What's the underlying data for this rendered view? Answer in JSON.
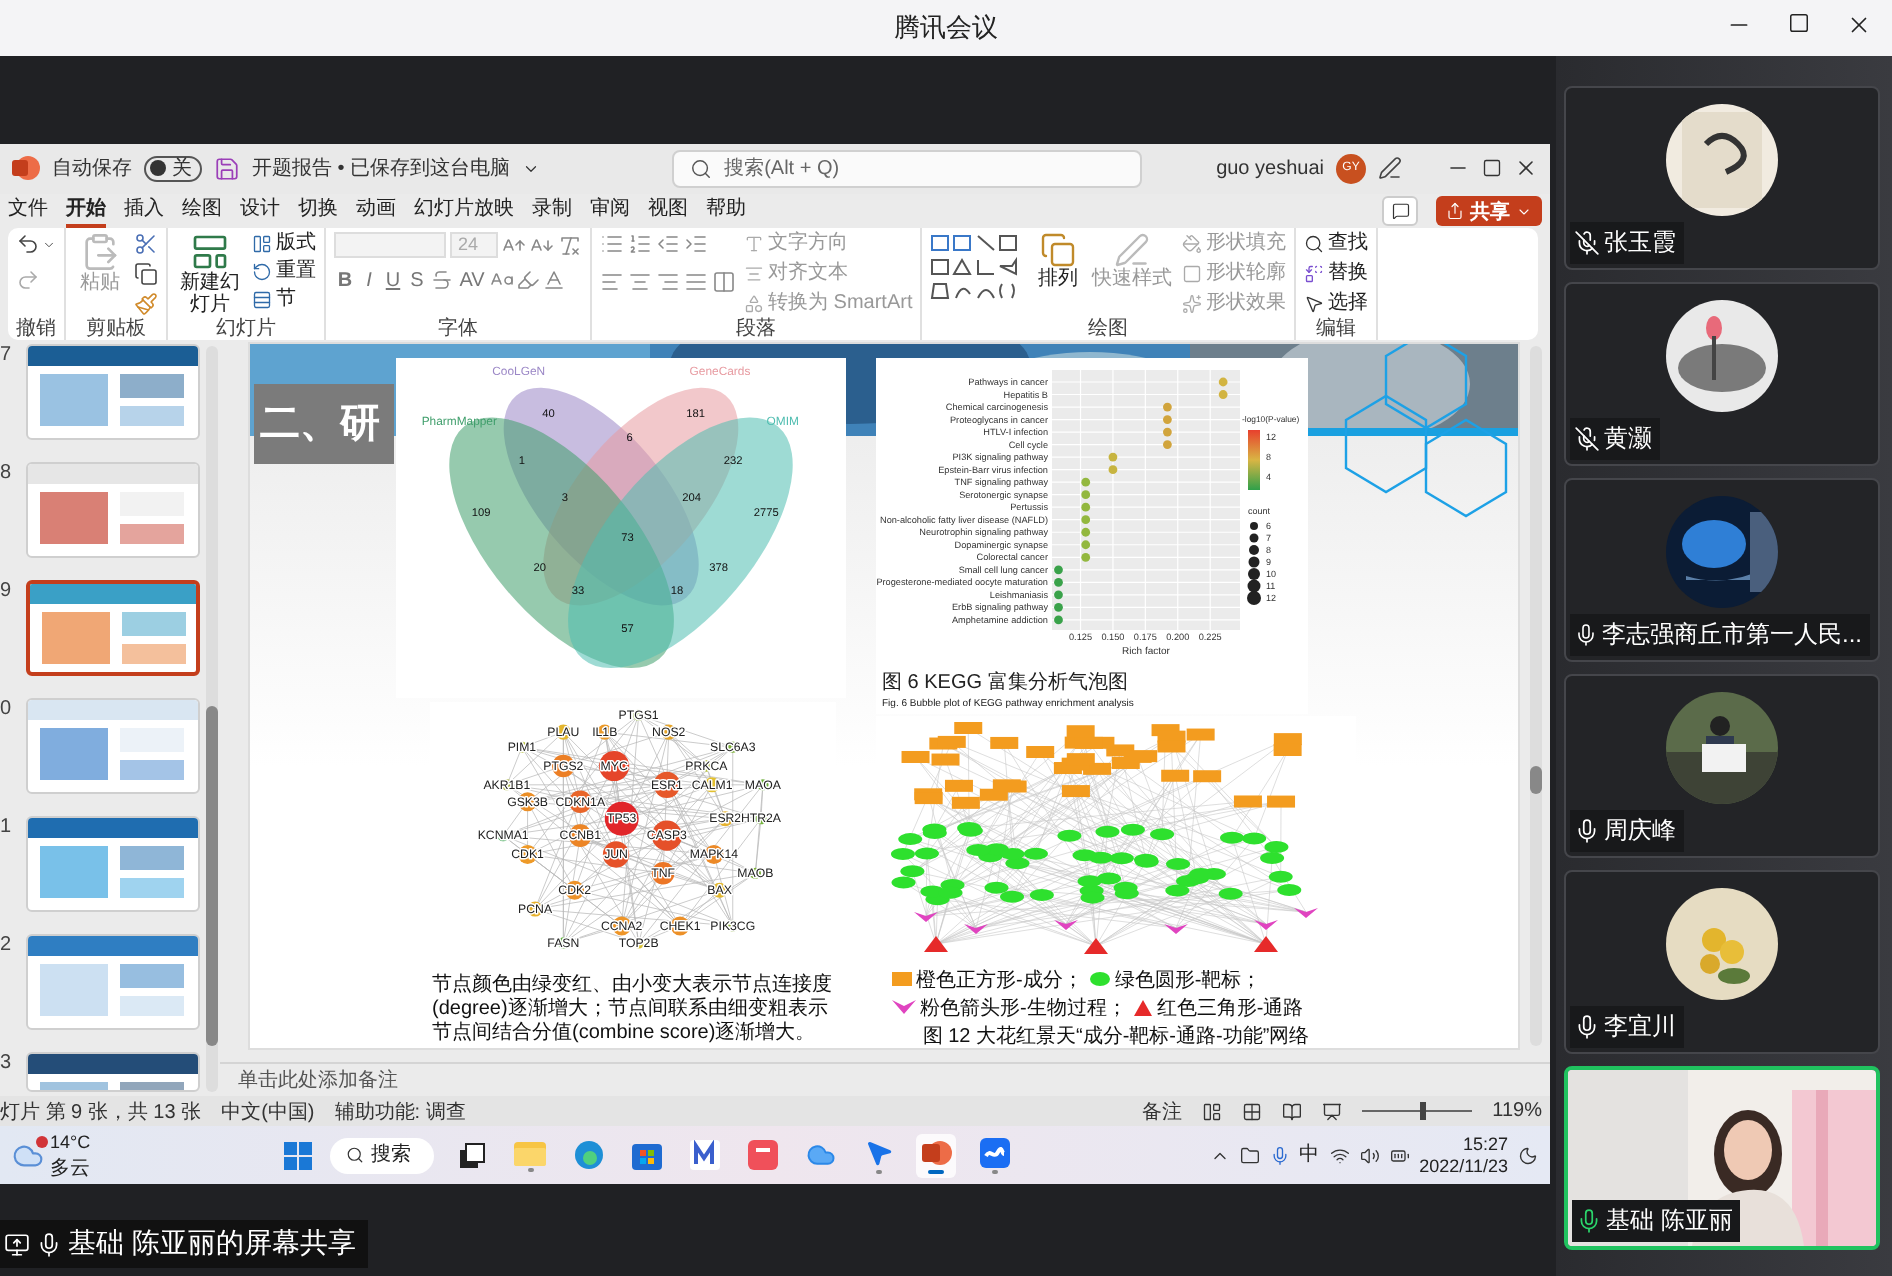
{
  "meeting": {
    "title": "腾讯会议"
  },
  "powerpoint": {
    "autosave_label": "自动保存",
    "autosave_toggle": {
      "label": "关",
      "on": false
    },
    "file_title": "开题报告 • 已保存到这台电脑",
    "search": {
      "placeholder": "搜索(Alt + Q)"
    },
    "user": {
      "name": "guo yeshuai",
      "initials": "GY"
    },
    "share_button": "共享",
    "menu_tabs": [
      {
        "label": "文件",
        "selected": false
      },
      {
        "label": "开始",
        "selected": true
      },
      {
        "label": "插入",
        "selected": false
      },
      {
        "label": "绘图",
        "selected": false
      },
      {
        "label": "设计",
        "selected": false
      },
      {
        "label": "切换",
        "selected": false
      },
      {
        "label": "动画",
        "selected": false
      },
      {
        "label": "幻灯片放映",
        "selected": false
      },
      {
        "label": "录制",
        "selected": false
      },
      {
        "label": "审阅",
        "selected": false
      },
      {
        "label": "视图",
        "selected": false
      },
      {
        "label": "帮助",
        "selected": false
      }
    ],
    "ribbon": [
      {
        "kind": "undo",
        "title": "撤销"
      },
      {
        "kind": "clipboard",
        "title": "剪贴板",
        "paste": {
          "label": "粘贴",
          "disabled": true
        }
      },
      {
        "kind": "slides",
        "title": "幻灯片",
        "new_slide": "新建幻灯片",
        "items": [
          "版式",
          "重置",
          "节"
        ]
      },
      {
        "kind": "font",
        "title": "字体",
        "font_size": {
          "value": "24",
          "disabled": true
        },
        "format_letters": [
          "B",
          "I",
          "U",
          "S"
        ],
        "spacing": "AV"
      },
      {
        "kind": "paragraph",
        "title": "段落",
        "items": [
          {
            "label": "文字方向",
            "disabled": true
          },
          {
            "label": "对齐文本",
            "disabled": true
          },
          {
            "label": "转换为 SmartArt",
            "disabled": true
          }
        ]
      },
      {
        "kind": "drawing",
        "title": "绘图",
        "arrange": "排列",
        "quick_styles": {
          "label": "快速样式",
          "disabled": true
        },
        "items": [
          {
            "label": "形状填充",
            "disabled": true
          },
          {
            "label": "形状轮廓",
            "disabled": true
          },
          {
            "label": "形状效果",
            "disabled": true
          }
        ]
      },
      {
        "kind": "editing",
        "title": "编辑",
        "items": [
          "查找",
          "替换",
          "选择"
        ]
      }
    ],
    "thumbnails": [
      {
        "number": "7",
        "selected": false
      },
      {
        "number": "8",
        "selected": false
      },
      {
        "number": "9",
        "selected": true
      },
      {
        "number": "0",
        "selected": false
      },
      {
        "number": "1",
        "selected": false
      },
      {
        "number": "2",
        "selected": false
      },
      {
        "number": "3",
        "selected": false
      }
    ],
    "slide": {
      "title": "二、研",
      "venn": {
        "sets": [
          {
            "name": "CooLGeN",
            "color": "#9b87c6"
          },
          {
            "name": "GeneCards",
            "color": "#e79aa0"
          },
          {
            "name": "PharmMapper",
            "color": "#3f9e6b"
          },
          {
            "name": "OMIM",
            "color": "#4fbdb0"
          }
        ],
        "counts": [
          "40",
          "181",
          "6",
          "1",
          "232",
          "109",
          "3",
          "204",
          "2775",
          "73",
          "20",
          "378",
          "33",
          "18",
          "57"
        ]
      },
      "ppi_network": {
        "nodes": [
          {
            "label": "PTGS1",
            "color": "#8fb339"
          },
          {
            "label": "PLAU",
            "color": "#e3b52d"
          },
          {
            "label": "IL1B",
            "color": "#eb9a2a"
          },
          {
            "label": "NOS2",
            "color": "#e6a52a"
          },
          {
            "label": "PIM1",
            "color": "#b6c13a"
          },
          {
            "label": "SLC6A3",
            "color": "#7fb23c"
          },
          {
            "label": "PTGS2",
            "color": "#ec7f25"
          },
          {
            "label": "MYC",
            "color": "#e5452a"
          },
          {
            "label": "PRKCA",
            "color": "#b7c23a"
          },
          {
            "label": "AKR1B1",
            "color": "#a8b43b"
          },
          {
            "label": "ESR1",
            "color": "#e6582a"
          },
          {
            "label": "CALM1",
            "color": "#e3c02f"
          },
          {
            "label": "MAOA",
            "color": "#6fb03d"
          },
          {
            "label": "GSK3B",
            "color": "#eb8f27"
          },
          {
            "label": "CDKN1A",
            "color": "#e9652a"
          },
          {
            "label": "TP53",
            "color": "#e1262a"
          },
          {
            "label": "ESR2",
            "color": "#e6b22c"
          },
          {
            "label": "HTR2A",
            "color": "#74b23d"
          },
          {
            "label": "KCNMA1",
            "color": "#2f9e44"
          },
          {
            "label": "CCNB1",
            "color": "#ec8526"
          },
          {
            "label": "CASP3",
            "color": "#e5502a"
          },
          {
            "label": "CDK1",
            "color": "#ee9a28"
          },
          {
            "label": "JUN",
            "color": "#e65229"
          },
          {
            "label": "MAPK14",
            "color": "#ec8a28"
          },
          {
            "label": "TNF",
            "color": "#ec7626"
          },
          {
            "label": "MAOB",
            "color": "#7eb33c"
          },
          {
            "label": "CDK2",
            "color": "#ee9228"
          },
          {
            "label": "BAX",
            "color": "#e3b82e"
          },
          {
            "label": "PCNA",
            "color": "#e8b22c"
          },
          {
            "label": "CCNA2",
            "color": "#ee9528"
          },
          {
            "label": "CHEK1",
            "color": "#ec9028"
          },
          {
            "label": "PIK3CG",
            "color": "#8db33b"
          },
          {
            "label": "FASN",
            "color": "#5fae3f"
          },
          {
            "label": "TOP2B",
            "color": "#d9c232"
          }
        ],
        "caption": "节点颜色由绿变红、由小变大表示节点连接度(degree)逐渐增大；节点间联系由细变粗表示节点间结合分值(combine score)逐渐增大。"
      },
      "bubble_chart": {
        "chart_data": {
          "type": "scatter",
          "orientation": "horizontal",
          "xlabel": "Rich factor",
          "grid": true,
          "categories": [
            "Pathways in cancer",
            "Hepatitis B",
            "Chemical carcinogenesis",
            "Proteoglycans in cancer",
            "HTLV-I infection",
            "Cell cycle",
            "PI3K signaling pathway",
            "Epstein-Barr virus infection",
            "TNF signaling pathway",
            "Serotonergic synapse",
            "Pertussis",
            "Non-alcoholic fatty liver disease (NAFLD)",
            "Neurotrophin signaling pathway",
            "Dopaminergic synapse",
            "Colorectal cancer",
            "Small cell lung cancer",
            "Progesterone-mediated oocyte maturation",
            "Leishmaniasis",
            "ErbB signaling pathway",
            "Amphetamine addiction"
          ],
          "values": [
            0.235,
            0.235,
            0.192,
            0.192,
            0.192,
            0.192,
            0.15,
            0.15,
            0.129,
            0.129,
            0.129,
            0.129,
            0.129,
            0.129,
            0.129,
            0.108,
            0.108,
            0.108,
            0.108,
            0.108
          ],
          "xlim": [
            0.103,
            0.248
          ],
          "xticks": [
            {
              "value": 0.125,
              "label": "0.125"
            },
            {
              "value": 0.15,
              "label": "0.150"
            },
            {
              "value": 0.175,
              "label": "0.175"
            },
            {
              "value": 0.2,
              "label": "0.200"
            },
            {
              "value": 0.225,
              "label": "0.225"
            }
          ]
        },
        "color_legend": {
          "title": "-log10(P-value)",
          "labels": [
            "12",
            "8",
            "4"
          ]
        },
        "size_legend": {
          "title": "count",
          "labels": [
            "6",
            "7",
            "8",
            "9",
            "10",
            "11",
            "12"
          ]
        },
        "caption_cn": "图 6  KEGG 富集分析气泡图",
        "caption_en": "Fig. 6  Bubble plot of KEGG pathway enrichment analysis"
      },
      "herb_network": {
        "legend": [
          {
            "kind": "square",
            "label": "橙色正方形-成分；"
          },
          {
            "kind": "circle",
            "label": "绿色圆形-靶标；"
          },
          {
            "kind": "arrow",
            "label": "粉色箭头形-生物过程；"
          },
          {
            "kind": "triangle",
            "label": "红色三角形-通路"
          }
        ],
        "caption": "图 12 大花红景天“成分-靶标-通路-功能”网络"
      }
    },
    "notes_placeholder": "单击此处添加备注",
    "status_bar": {
      "slide_info": "灯片 第 9 张，共 13 张",
      "language": "中文(中国)",
      "accessibility": "辅助功能: 调查",
      "notes_button": "备注",
      "zoom": {
        "level": 0.53,
        "reading": "119%"
      }
    },
    "taskbar": {
      "weather": {
        "temp": "14°C",
        "condition": "多云"
      },
      "search": "搜索",
      "apps": [
        {
          "kind": "taskview",
          "running": false,
          "active": false
        },
        {
          "kind": "explorer",
          "running": true,
          "active": false
        },
        {
          "kind": "edge",
          "running": false,
          "active": false
        },
        {
          "kind": "store",
          "running": false,
          "active": false
        },
        {
          "kind": "m-app",
          "running": false,
          "active": false
        },
        {
          "kind": "red-app",
          "running": false,
          "active": false
        },
        {
          "kind": "cloud",
          "running": false,
          "active": false
        },
        {
          "kind": "pointer",
          "running": true,
          "active": false
        },
        {
          "kind": "powerpoint",
          "running": true,
          "active": true
        },
        {
          "kind": "meeting",
          "running": true,
          "active": false
        }
      ],
      "ime": "中",
      "time": "15:27",
      "date": "2022/11/23"
    }
  },
  "participants": [
    {
      "name": "张玉霞",
      "muted": true,
      "speaking": false,
      "kind": "avatar"
    },
    {
      "name": "黄灏",
      "muted": true,
      "speaking": false,
      "kind": "avatar"
    },
    {
      "name": "李志强商丘市第一人民...",
      "muted": false,
      "speaking": false,
      "kind": "avatar"
    },
    {
      "name": "周庆峰",
      "muted": false,
      "speaking": false,
      "kind": "avatar"
    },
    {
      "name": "李宜川",
      "muted": false,
      "speaking": false,
      "kind": "avatar"
    },
    {
      "name": "基础 陈亚丽",
      "muted": false,
      "speaking": true,
      "kind": "video"
    }
  ],
  "share_label": "基础 陈亚丽的屏幕共享"
}
